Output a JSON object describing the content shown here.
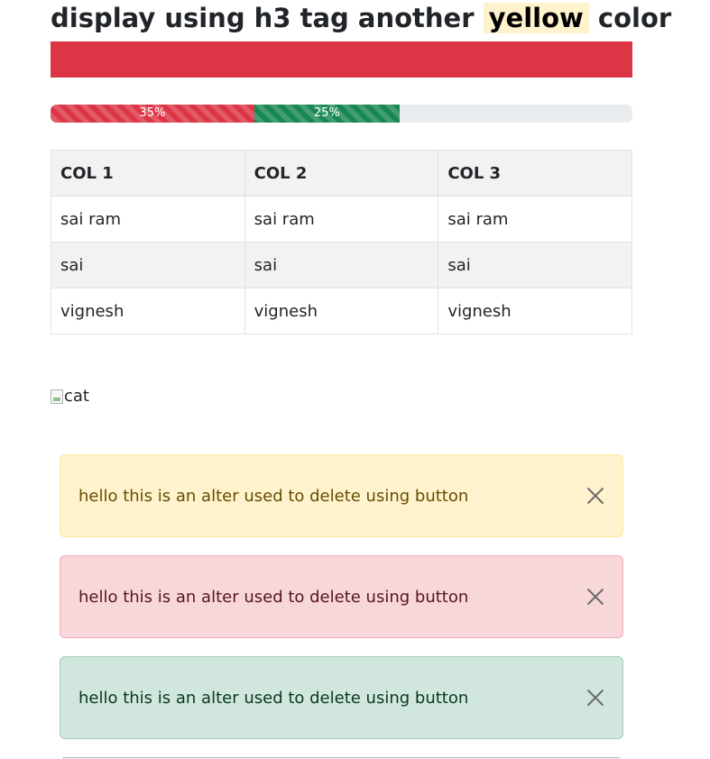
{
  "heading": {
    "before": "display using h3 tag another",
    "highlight": "yellow",
    "after": "color"
  },
  "colors": {
    "danger": "#dc3545",
    "success": "#198754",
    "warning_bg": "#fff3cd"
  },
  "progress": {
    "segments": [
      {
        "label": "35%",
        "value": 35,
        "color": "#dc3545"
      },
      {
        "label": "25%",
        "value": 25,
        "color": "#198754"
      }
    ]
  },
  "table": {
    "headers": [
      "COL 1",
      "COL 2",
      "COL 3"
    ],
    "rows": [
      [
        "sai ram",
        "sai ram",
        "sai ram"
      ],
      [
        "sai",
        "sai",
        "sai"
      ],
      [
        "vignesh",
        "vignesh",
        "vignesh"
      ]
    ]
  },
  "image": {
    "alt": "cat"
  },
  "alerts": [
    {
      "message": "hello this is an alter used to delete using button",
      "variant": "warning"
    },
    {
      "message": "hello this is an alter used to delete using button",
      "variant": "danger"
    },
    {
      "message": "hello this is an alter used to delete using button",
      "variant": "success"
    }
  ]
}
